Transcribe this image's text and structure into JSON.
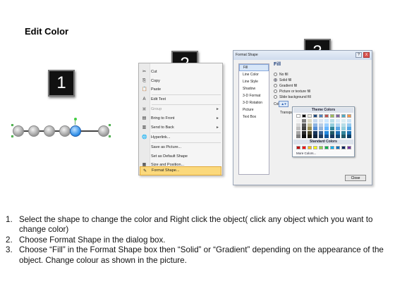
{
  "page_title": "Edit Color",
  "badges": [
    "1",
    "2",
    "3"
  ],
  "context_menu": {
    "items": [
      {
        "label": "Cut",
        "icon": "scissors-icon",
        "glyph": "✂",
        "disabled": false,
        "submenu": false
      },
      {
        "label": "Copy",
        "icon": "copy-icon",
        "glyph": "⎘",
        "disabled": false,
        "submenu": false
      },
      {
        "label": "Paste",
        "icon": "paste-icon",
        "glyph": "📋",
        "disabled": false,
        "submenu": false
      },
      {
        "label": "Edit Text",
        "icon": "text-icon",
        "glyph": "A",
        "disabled": false,
        "submenu": false
      },
      {
        "label": "Group",
        "icon": "group-icon",
        "glyph": "▣",
        "disabled": true,
        "submenu": true
      },
      {
        "label": "Bring to Front",
        "icon": "bring-front-icon",
        "glyph": "▤",
        "disabled": false,
        "submenu": true
      },
      {
        "label": "Send to Back",
        "icon": "send-back-icon",
        "glyph": "▥",
        "disabled": false,
        "submenu": true
      },
      {
        "label": "Hyperlink...",
        "icon": "hyperlink-icon",
        "glyph": "🌐",
        "disabled": false,
        "submenu": false
      },
      {
        "label": "Save as Picture...",
        "icon": "",
        "glyph": "",
        "disabled": false,
        "submenu": false
      },
      {
        "label": "Set as Default Shape",
        "icon": "",
        "glyph": "",
        "disabled": false,
        "submenu": false
      },
      {
        "label": "Size and Position...",
        "icon": "size-icon",
        "glyph": "▦",
        "disabled": false,
        "submenu": false
      },
      {
        "label": "Format Shape...",
        "icon": "format-shape-icon",
        "glyph": "✎",
        "disabled": false,
        "submenu": false,
        "highlighted": true
      }
    ]
  },
  "dialog": {
    "title": "Format Shape",
    "title_buttons": [
      "?",
      "X"
    ],
    "categories": [
      "Fill",
      "Line Color",
      "Line Style",
      "Shadow",
      "3-D Format",
      "3-D Rotation",
      "Picture",
      "Text Box"
    ],
    "selected_category": "Fill",
    "section_heading": "Fill",
    "fill_options": [
      {
        "label": "No fill",
        "type": "radio",
        "selected": false
      },
      {
        "label": "Solid fill",
        "type": "radio",
        "selected": true
      },
      {
        "label": "Gradient fill",
        "type": "radio",
        "selected": false
      },
      {
        "label": "Picture or texture fill",
        "type": "radio",
        "selected": false
      },
      {
        "label": "Slide background fill",
        "type": "radio",
        "selected": false
      }
    ],
    "color_label": "Color:",
    "transparency_label": "Transpa",
    "close_label": "Close"
  },
  "palette": {
    "theme_heading": "Theme Colors",
    "standard_heading": "Standard Colors",
    "more_label": "More Colors...",
    "theme_top_row": [
      "#ffffff",
      "#000000",
      "#eeece1",
      "#1f497d",
      "#4f81bd",
      "#c0504d",
      "#9bbb59",
      "#8064a2",
      "#4bacc6",
      "#f79646"
    ],
    "theme_columns": [
      [
        "#f2f2f2",
        "#d9d9d9",
        "#bfbfbf",
        "#a6a6a6",
        "#7f7f7f"
      ],
      [
        "#7f7f7f",
        "#595959",
        "#404040",
        "#262626",
        "#0d0d0d"
      ],
      [
        "#ddd9c3",
        "#c4bd97",
        "#938953",
        "#494429",
        "#1d1b10"
      ],
      [
        "#c6d9f0",
        "#8db3e2",
        "#548dd4",
        "#17365d",
        "#0f243e"
      ],
      [
        "#dbe5f1",
        "#b8cce4",
        "#95b3d7",
        "#366092",
        "#244061"
      ],
      [
        "#cce7ff",
        "#99ceff",
        "#66b5ff",
        "#2288dd",
        "#115599"
      ],
      [
        "#b7dde8",
        "#92cddc",
        "#31859b",
        "#205867",
        "#17375e"
      ],
      [
        "#d6e9f8",
        "#add3f1",
        "#5aa6e4",
        "#1f6fb5",
        "#124876"
      ],
      [
        "#daeef3",
        "#b6dde8",
        "#92cddc",
        "#31859b",
        "#215968"
      ],
      [
        "#c9e4f7",
        "#93c9ef",
        "#4fa5e3",
        "#1a6eae",
        "#0e3f66"
      ]
    ],
    "standard_colors": [
      "#c00000",
      "#ff0000",
      "#ffc000",
      "#ffff00",
      "#92d050",
      "#00b050",
      "#00b0f0",
      "#0070c0",
      "#002060",
      "#7030a0"
    ]
  },
  "instructions": [
    {
      "num": "1.",
      "text": "Select the shape to change the color and Right click the object( click any object which you want to change color)"
    },
    {
      "num": "2.",
      "text": "Choose Format Shape in the dialog box."
    },
    {
      "num": "3.",
      "text": "Choose “Fill” in the Format Shape box then “Solid” or “Gradient” depending on the appearance of the object. Change colour as shown in the picture."
    }
  ]
}
